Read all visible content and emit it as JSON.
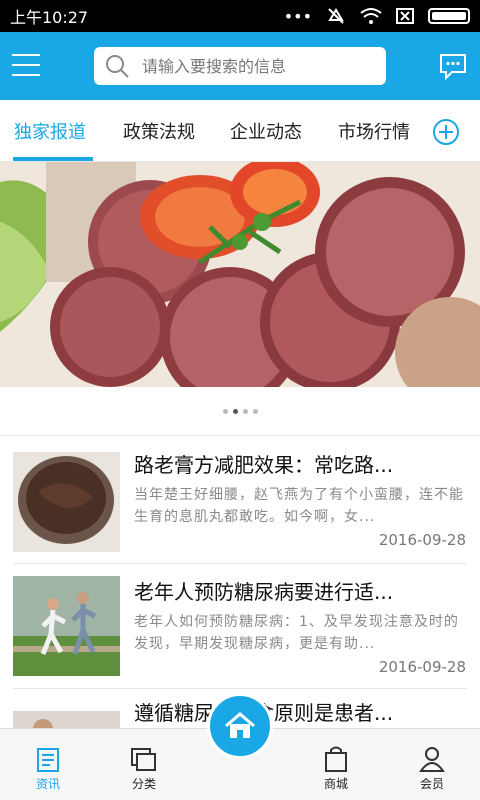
{
  "status_bar": {
    "time": "上午10:27"
  },
  "header": {
    "search_placeholder": "请输入要搜索的信息",
    "accent_color": "#1aa7e6"
  },
  "tabs": [
    {
      "label": "独家报道",
      "active": true
    },
    {
      "label": "政策法规",
      "active": false
    },
    {
      "label": "企业动态",
      "active": false
    },
    {
      "label": "市场行情",
      "active": false
    }
  ],
  "banner": {
    "slide_count": 4,
    "active_index": 1
  },
  "news": [
    {
      "title": "路老膏方减肥效果：常吃路...",
      "summary": "当年楚王好细腰，赵飞燕为了有个小蛮腰，连不能生育的息肌丸都敢吃。如今啊，女...",
      "date": "2016-09-28"
    },
    {
      "title": "老年人预防糖尿病要进行适...",
      "summary": "老年人如何预防糖尿病：1、及早发现注意及时的发现，早期发现糖尿病，更是有助...",
      "date": "2016-09-28"
    },
    {
      "title": "遵循糖尿病饮食原则是患者...",
      "summary": "",
      "date": ""
    }
  ],
  "bottom_nav": [
    {
      "label": "资讯",
      "icon": "news-icon",
      "active": true
    },
    {
      "label": "分类",
      "icon": "category-icon",
      "active": false
    },
    {
      "label": "",
      "icon": "home-icon",
      "active": false
    },
    {
      "label": "商城",
      "icon": "shopping-bag-icon",
      "active": false
    },
    {
      "label": "会员",
      "icon": "user-icon",
      "active": false
    }
  ]
}
